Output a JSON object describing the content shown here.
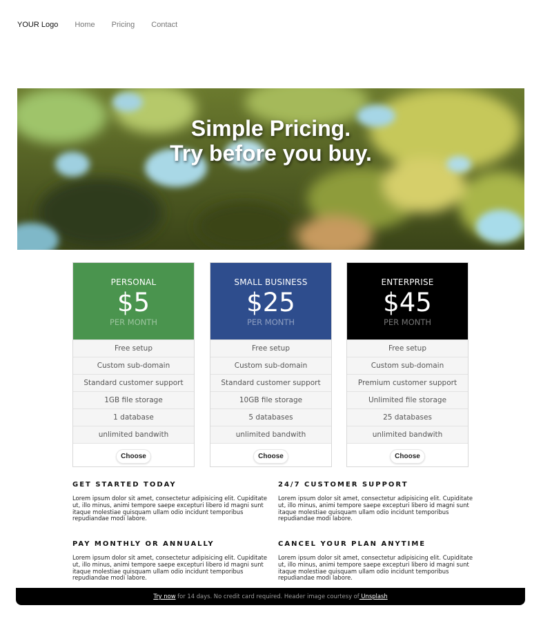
{
  "nav": {
    "logo": "YOUR Logo",
    "links": [
      "Home",
      "Pricing",
      "Contact"
    ]
  },
  "hero": {
    "title_line1": "Simple Pricing.",
    "title_line2": "Try before you buy."
  },
  "plans": [
    {
      "name": "PERSONAL",
      "price": "$5",
      "period": "PER MONTH",
      "color": "#4a944e",
      "features": [
        "Free setup",
        "Custom sub-domain",
        "Standard customer support",
        "1GB file storage",
        "1 database",
        "unlimited bandwith"
      ],
      "button": "Choose"
    },
    {
      "name": "SMALL BUSINESS",
      "price": "$25",
      "period": "PER MONTH",
      "color": "#2e4d8d",
      "features": [
        "Free setup",
        "Custom sub-domain",
        "Standard customer support",
        "10GB file storage",
        "5 databases",
        "unlimited bandwith"
      ],
      "button": "Choose"
    },
    {
      "name": "ENTERPRISE",
      "price": "$45",
      "period": "PER MONTH",
      "color": "#000000",
      "features": [
        "Free setup",
        "Custom sub-domain",
        "Premium customer support",
        "Unlimited file storage",
        "25 databases",
        "unlimited bandwith"
      ],
      "button": "Choose"
    }
  ],
  "sections": [
    {
      "heading": "GET STARTED TODAY",
      "body": "Lorem ipsum dolor sit amet, consectetur adipisicing elit. Cupiditate ut, illo minus, animi tempore saepe excepturi libero id magni sunt itaque molestiae quisquam ullam odio incidunt temporibus repudiandae modi labore."
    },
    {
      "heading": "24/7 CUSTOMER SUPPORT",
      "body": "Lorem ipsum dolor sit amet, consectetur adipisicing elit. Cupiditate ut, illo minus, animi tempore saepe excepturi libero id magni sunt itaque molestiae quisquam ullam odio incidunt temporibus repudiandae modi labore."
    },
    {
      "heading": "PAY MONTHLY OR ANNUALLY",
      "body": "Lorem ipsum dolor sit amet, consectetur adipisicing elit. Cupiditate ut, illo minus, animi tempore saepe excepturi libero id magni sunt itaque molestiae quisquam ullam odio incidunt temporibus repudiandae modi labore."
    },
    {
      "heading": "CANCEL YOUR PLAN ANYTIME",
      "body": "Lorem ipsum dolor sit amet, consectetur adipisicing elit. Cupiditate ut, illo minus, animi tempore saepe excepturi libero id magni sunt itaque molestiae quisquam ullam odio incidunt temporibus repudiandae modi labore."
    }
  ],
  "footer": {
    "try_link": "Try now",
    "text": " for 14 days. No credit card required. Header image courtesy of",
    "unsplash_link": " Unsplash"
  }
}
